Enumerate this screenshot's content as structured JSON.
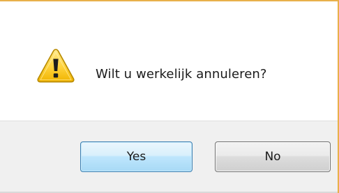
{
  "dialog": {
    "message": "Wilt u werkelijk annuleren?",
    "icon": "warning-icon",
    "accent_color": "#e8b04a"
  },
  "buttons": {
    "yes_label": "Yes",
    "no_label": "No"
  }
}
